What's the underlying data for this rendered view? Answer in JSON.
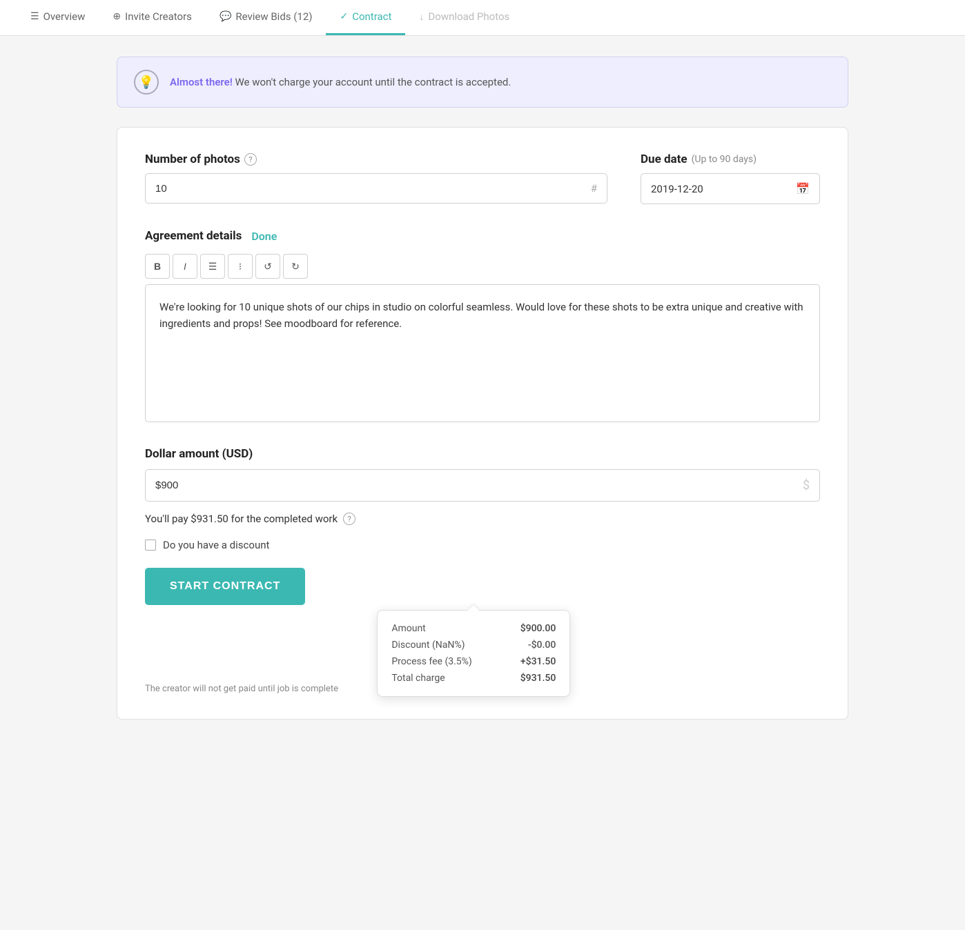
{
  "nav": {
    "items": [
      {
        "id": "overview",
        "label": "Overview",
        "icon": "☰",
        "state": "normal"
      },
      {
        "id": "invite",
        "label": "Invite Creators",
        "icon": "⊕",
        "state": "normal"
      },
      {
        "id": "review",
        "label": "Review Bids (12)",
        "icon": "💬",
        "state": "normal"
      },
      {
        "id": "contract",
        "label": "Contract",
        "icon": "✓",
        "state": "active"
      },
      {
        "id": "download",
        "label": "Download Photos",
        "icon": "↓",
        "state": "disabled"
      }
    ]
  },
  "alert": {
    "icon": "💡",
    "highlight": "Almost there!",
    "message": " We won't charge your account until the contract is accepted."
  },
  "form": {
    "photos_label": "Number of photos",
    "photos_value": "10",
    "photos_suffix": "#",
    "photos_help": "?",
    "due_date_label": "Due date",
    "due_date_sub": "(Up to 90 days)",
    "due_date_value": "2019-12-20",
    "agreement_label": "Agreement details",
    "agreement_done": "Done",
    "editor_content": "We're looking for 10 unique shots of our chips in studio on colorful seamless. Would love for these shots to be extra unique and creative with ingredients and props! See moodboard for reference.",
    "dollar_label": "Dollar amount (USD)",
    "dollar_value": "$900",
    "dollar_placeholder": "$900",
    "pay_summary": "You'll pay $931.50 for the completed work",
    "discount_label": "Do you have a discount",
    "start_btn": "START CONTRACT",
    "footer_note": "The creator will not get paid until job is complete"
  },
  "toolbar": {
    "bold": "B",
    "italic": "I",
    "ordered_list": "≡",
    "unordered_list": "≡",
    "undo": "↺",
    "redo": "↻"
  },
  "tooltip": {
    "amount_label": "Amount",
    "amount_value": "$900.00",
    "discount_label": "Discount (NaN%)",
    "discount_value": "-$0.00",
    "fee_label": "Process fee (3.5%)",
    "fee_value": "+$31.50",
    "total_label": "Total charge",
    "total_value": "$931.50"
  }
}
